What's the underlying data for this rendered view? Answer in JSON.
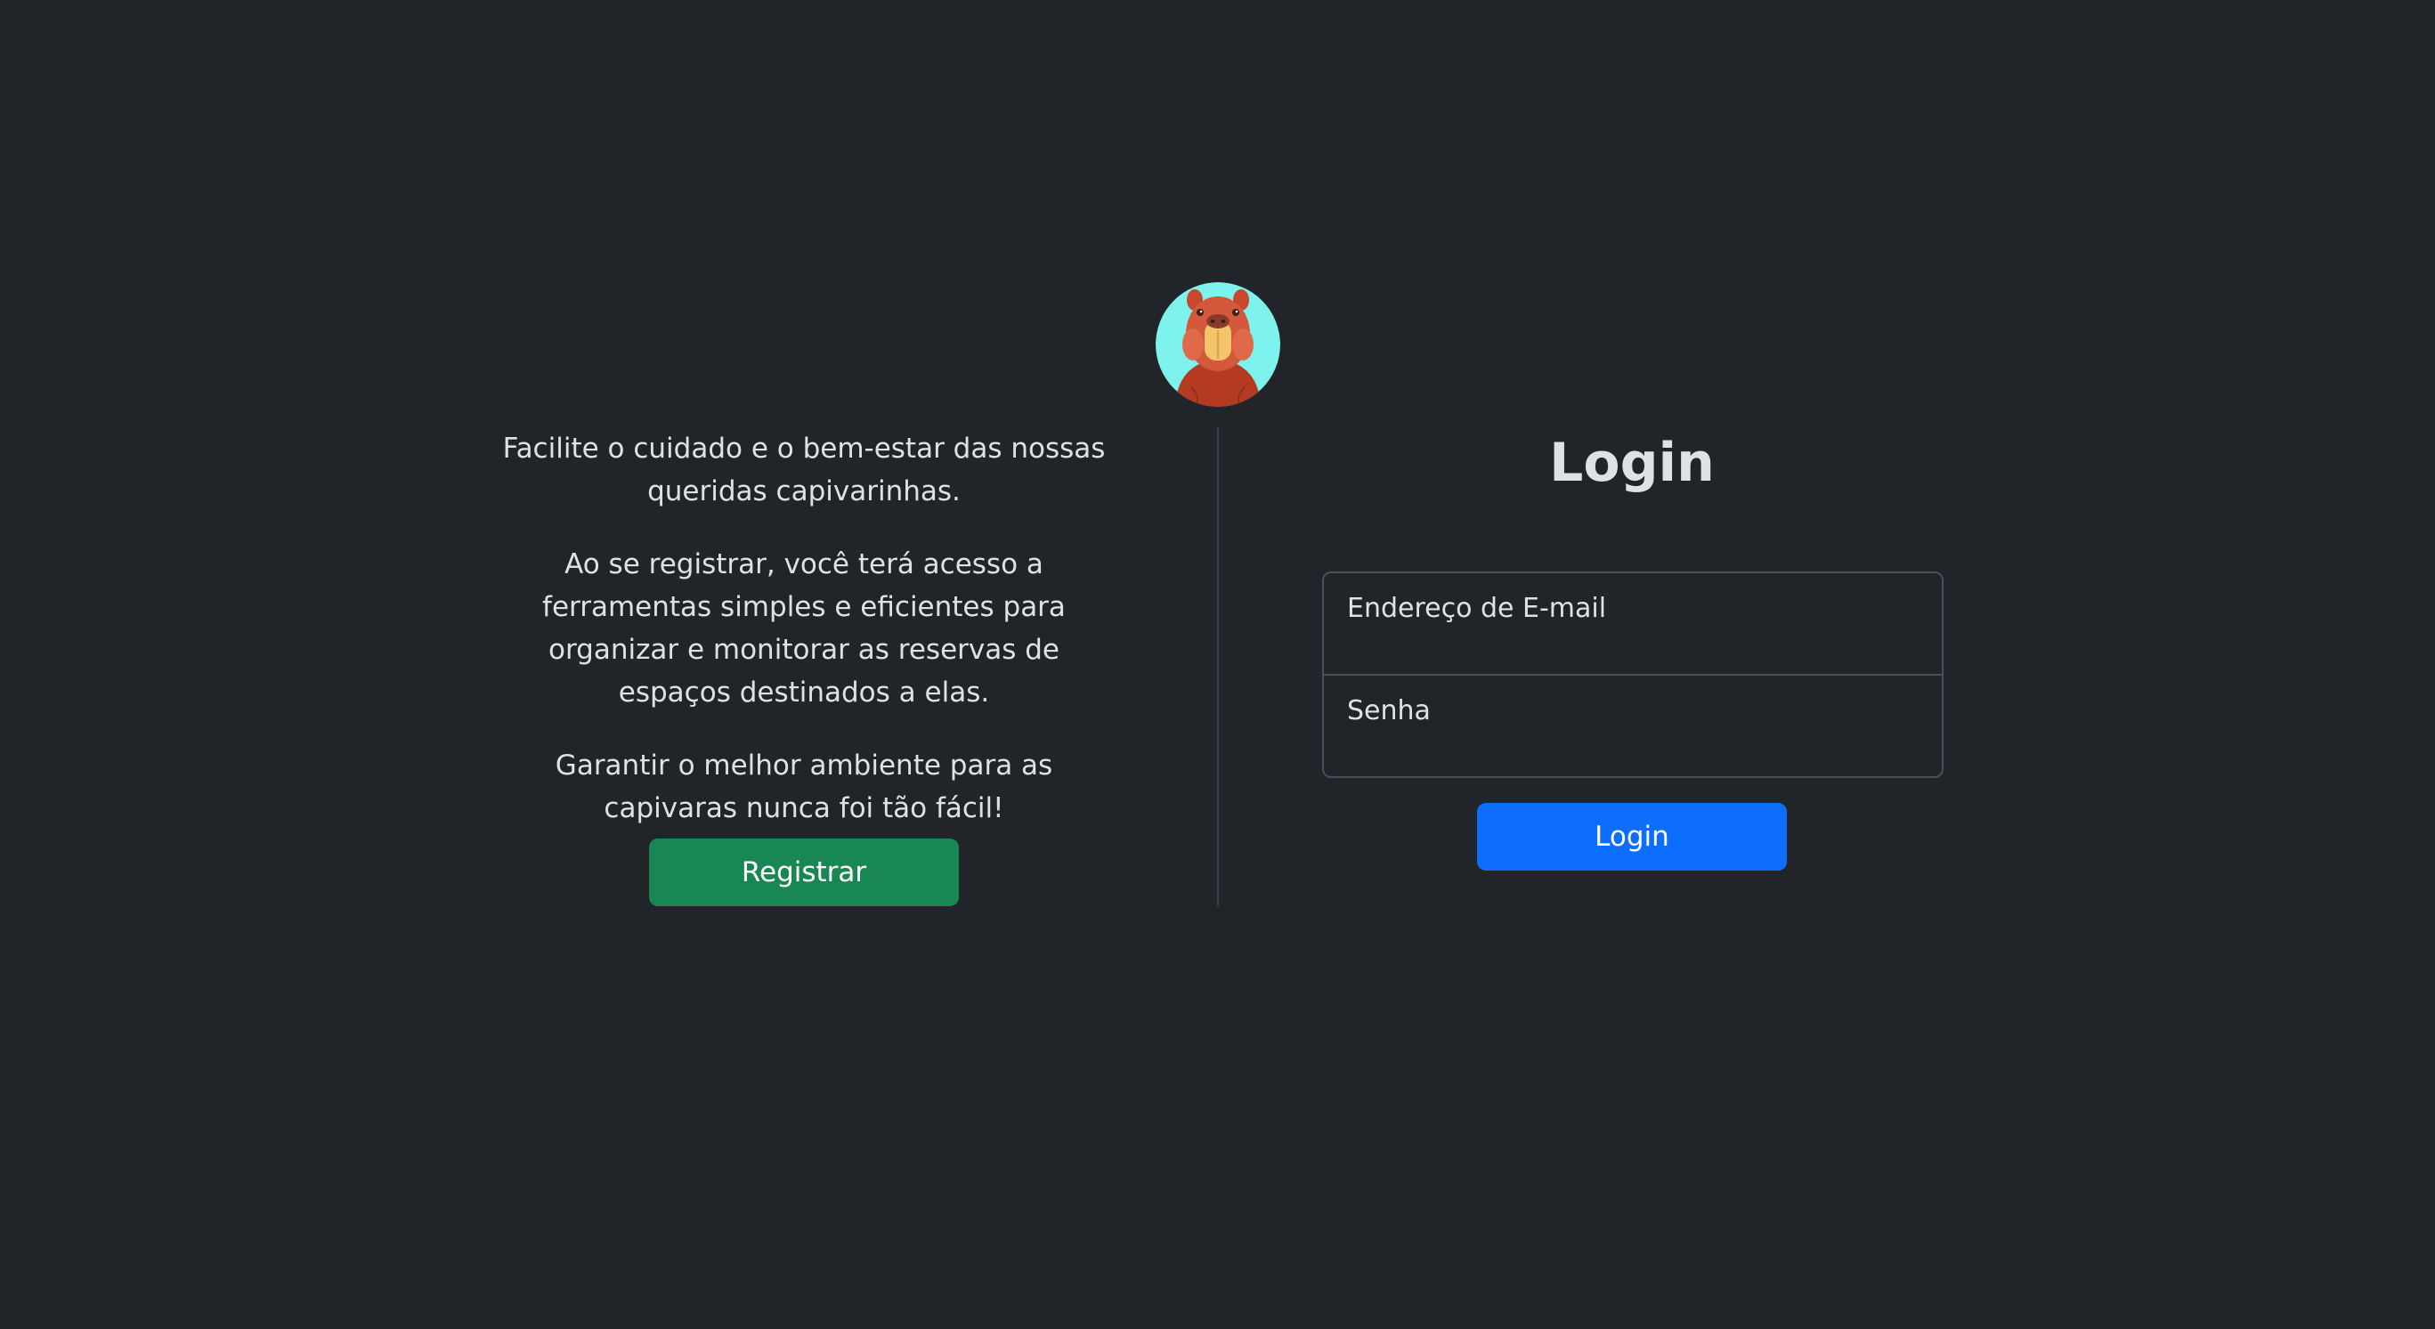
{
  "logo": {
    "icon": "capybara-icon",
    "bg_color": "#7ef3ee"
  },
  "intro": {
    "paragraph_1": "Facilite o cuidado e o bem-estar das nossas queridas capivarinhas.",
    "paragraph_2": "Ao se registrar, você terá acesso a ferramentas simples e eficientes para organizar e monitorar as reservas de espaços destinados a elas.",
    "paragraph_3": "Garantir o melhor ambiente para as capivaras nunca foi tão fácil!",
    "register_label": "Registrar"
  },
  "login": {
    "title": "Login",
    "email_label": "Endereço de E-mail",
    "email_value": "",
    "password_label": "Senha",
    "password_value": "",
    "submit_label": "Login"
  },
  "colors": {
    "background": "#212529",
    "register_button": "#198754",
    "login_button": "#0d6efd",
    "text": "#dee2e6"
  }
}
